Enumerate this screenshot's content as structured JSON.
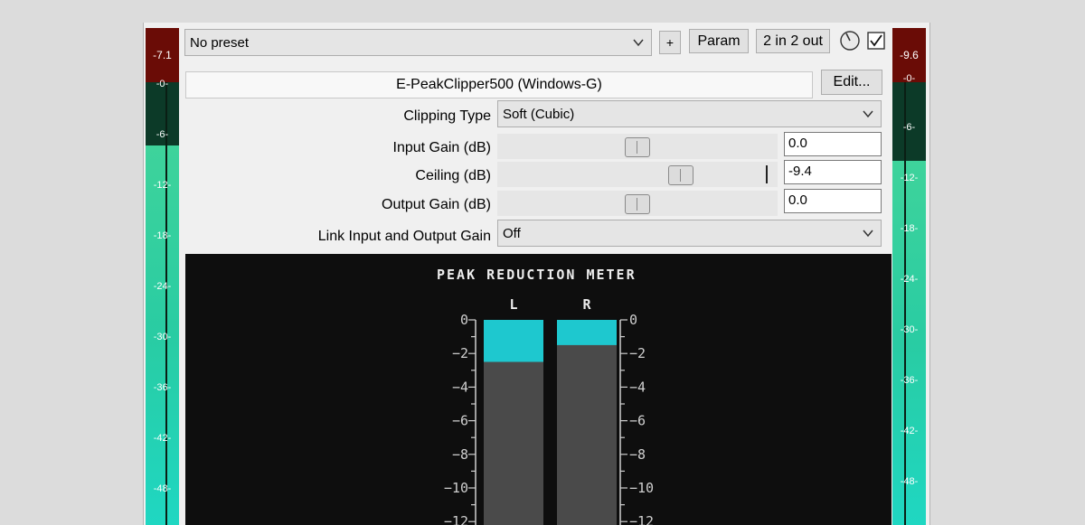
{
  "left_meter": {
    "peak": "-7.1",
    "ticks": [
      "-0-",
      "-6-",
      "-12-",
      "-18-",
      "-24-",
      "-30-",
      "-36-",
      "-42-",
      "-48-"
    ],
    "level_db": -7.1
  },
  "right_meter": {
    "peak": "-9.6",
    "ticks": [
      "-0-",
      "-6-",
      "-12-",
      "-18-",
      "-24-",
      "-30-",
      "-36-",
      "-42-",
      "-48-"
    ],
    "level_db": -9.6
  },
  "toolbar": {
    "preset": "No preset",
    "add_label": "+",
    "param_label": "Param",
    "io_label": "2 in 2 out",
    "bypass_checked": true
  },
  "plugin": {
    "name": "E-PeakClipper500 (Windows-G)",
    "edit_label": "Edit..."
  },
  "params": {
    "clipping_type": {
      "label": "Clipping Type",
      "value": "Soft (Cubic)"
    },
    "input_gain": {
      "label": "Input Gain (dB)",
      "value": "0.0",
      "fraction": 0.5
    },
    "ceiling": {
      "label": "Ceiling (dB)",
      "value": "-9.4",
      "fraction": 0.67
    },
    "output_gain": {
      "label": "Output Gain (dB)",
      "value": "0.0",
      "fraction": 0.5
    },
    "link": {
      "label": "Link Input and Output Gain",
      "value": "Off"
    }
  },
  "peak_meter": {
    "title": "PEAK REDUCTION METER",
    "channels": [
      {
        "name": "L",
        "reduction_db": 2.5
      },
      {
        "name": "R",
        "reduction_db": 1.5
      }
    ],
    "scale_labels": [
      "0",
      "−2",
      "−4",
      "−6",
      "−8",
      "−10",
      "−12"
    ],
    "bar_color": "#1ec8cf",
    "bar_bg_color": "#4a4a4a"
  }
}
